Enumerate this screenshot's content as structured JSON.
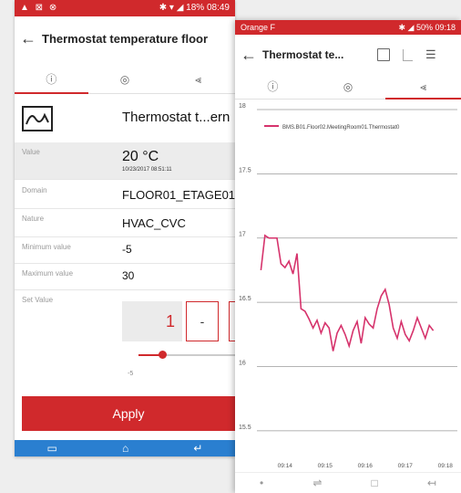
{
  "phone1": {
    "status_time": "08:49",
    "status_battery": "18%",
    "title": "Thermostat temperature floor",
    "tabs": [
      "ⓘ",
      "◎",
      "⪡"
    ],
    "device_name": "Thermostat t...ern",
    "value": {
      "label": "Value",
      "reading": "20 °C",
      "timestamp": "10/23/2017 08:51:11"
    },
    "domain": {
      "label": "Domain",
      "value": "FLOOR01_ETAGE01"
    },
    "nature": {
      "label": "Nature",
      "value": "HVAC_CVC"
    },
    "min": {
      "label": "Minimum value",
      "value": "-5"
    },
    "max": {
      "label": "Maximum value",
      "value": "30"
    },
    "setvalue": {
      "label": "Set Value",
      "value": "1",
      "minus": "-",
      "plus": "+",
      "slider_min": "-5",
      "slider_fraction": 0.17
    },
    "apply_label": "Apply",
    "nav": [
      "▭",
      "⌂",
      "↵"
    ]
  },
  "phone2": {
    "carrier": "Orange F",
    "status_right": "50% 09:18",
    "title": "Thermostat te...",
    "tabs": [
      "ⓘ",
      "◎",
      "⪡"
    ],
    "toolbar": {
      "calendar": "calendar-icon",
      "chart": "bar-chart-icon",
      "settings": "sliders-icon"
    },
    "nav": [
      "•",
      "⇌",
      "□",
      "↤"
    ]
  },
  "chart_data": {
    "type": "line",
    "title": "",
    "xlabel": "",
    "ylabel": "",
    "legend_position": "top-left",
    "grid": true,
    "ylim": [
      15.3,
      18
    ],
    "yticks": [
      "18",
      "17.5",
      "17",
      "16.5",
      "16",
      "15.5"
    ],
    "xticks": [
      "09:14",
      "09:15",
      "09:16",
      "09:17",
      "09:18"
    ],
    "series": [
      {
        "name": "BMS.B01.Floor02.MeetingRoom01.Thermostat0",
        "color": "#d6336c",
        "x": [
          "09:13.4",
          "09:13.5",
          "09:13.6",
          "09:13.8",
          "09:13.9",
          "09:14.0",
          "09:14.1",
          "09:14.2",
          "09:14.3",
          "09:14.4",
          "09:14.5",
          "09:14.6",
          "09:14.7",
          "09:14.8",
          "09:14.9",
          "09:15.0",
          "09:15.1",
          "09:15.2",
          "09:15.3",
          "09:15.4",
          "09:15.5",
          "09:15.6",
          "09:15.7",
          "09:15.8",
          "09:15.9",
          "09:16.0",
          "09:16.1",
          "09:16.2",
          "09:16.3",
          "09:16.4",
          "09:16.5",
          "09:16.6",
          "09:16.7",
          "09:16.8",
          "09:16.9",
          "09:17.0",
          "09:17.1",
          "09:17.2",
          "09:17.3",
          "09:17.4",
          "09:17.5",
          "09:17.6",
          "09:17.7"
        ],
        "y": [
          16.75,
          17.02,
          17.0,
          17.0,
          16.8,
          16.77,
          16.82,
          16.72,
          16.88,
          16.45,
          16.43,
          16.37,
          16.3,
          16.36,
          16.26,
          16.34,
          16.3,
          16.12,
          16.26,
          16.32,
          16.25,
          16.16,
          16.28,
          16.35,
          16.18,
          16.38,
          16.33,
          16.3,
          16.45,
          16.55,
          16.6,
          16.48,
          16.3,
          16.22,
          16.35,
          16.25,
          16.2,
          16.28,
          16.38,
          16.3,
          16.22,
          16.32,
          16.28
        ]
      }
    ]
  }
}
